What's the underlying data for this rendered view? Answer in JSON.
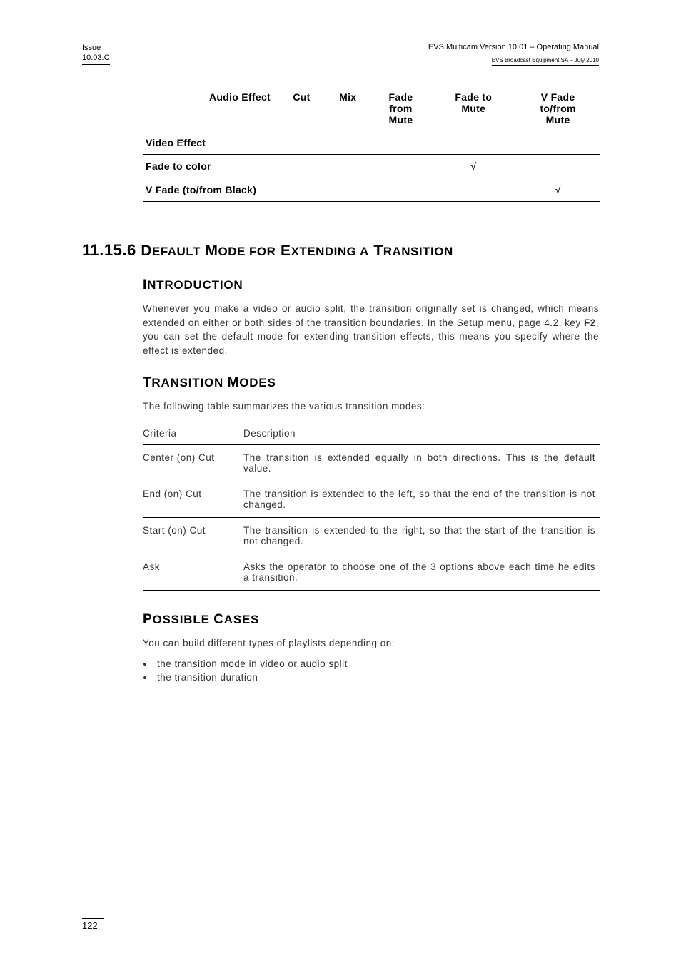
{
  "header": {
    "issue_label": "Issue",
    "issue_num": "10.03.C",
    "right_line1": "EVS Multicam Version 10.01 – Operating Manual",
    "right_line2": "EVS Broadcast Equipment SA – July 2010"
  },
  "effects_table": {
    "audio_effect_label": "Audio Effect",
    "headers": [
      "Cut",
      "Mix",
      "Fade from Mute",
      "Fade to Mute",
      "V Fade to/from Mute"
    ],
    "video_effect_label": "Video Effect",
    "rows": [
      {
        "label": "Fade to color",
        "marks": [
          "",
          "",
          "",
          "√",
          ""
        ]
      },
      {
        "label": "V Fade (to/from Black)",
        "marks": [
          "",
          "",
          "",
          "",
          "√"
        ]
      }
    ]
  },
  "section": {
    "number": "11.15.6",
    "title_word1_first": "D",
    "title_word1_rest": "EFAULT",
    "title_word2_first": "M",
    "title_word2_rest": "ODE FOR",
    "title_word3_first": "E",
    "title_word3_rest": "XTENDING A",
    "title_word4_first": "T",
    "title_word4_rest": "RANSITION"
  },
  "intro": {
    "heading_first": "I",
    "heading_rest": "NTRODUCTION",
    "text": "Whenever you make a video or audio split, the transition originally set is changed, which means extended on either or both sides of the transition boundaries. In the Setup menu, page 4.2, key F2, you can set the default mode for extending transition effects, this means you specify where the effect is extended."
  },
  "modes": {
    "heading_word1_first": "T",
    "heading_word1_rest": "RANSITION",
    "heading_word2_first": "M",
    "heading_word2_rest": "ODES",
    "intro": "The following table summarizes the various transition modes:",
    "col_criteria": "Criteria",
    "col_description": "Description",
    "rows": [
      {
        "crit": "Center (on) Cut",
        "desc": "The transition is extended equally in both directions. This is the default value."
      },
      {
        "crit": "End (on) Cut",
        "desc": "The transition is extended to the left, so that the end of the transition is not changed."
      },
      {
        "crit": "Start (on) Cut",
        "desc": "The transition is extended to the right, so that the start of the transition is not changed."
      },
      {
        "crit": "Ask",
        "desc": "Asks the operator to choose one of the 3 options above each time he edits a transition."
      }
    ]
  },
  "cases": {
    "heading_word1_first": "P",
    "heading_word1_rest": "OSSIBLE",
    "heading_word2_first": "C",
    "heading_word2_rest": "ASES",
    "intro": "You can build different types of playlists depending on:",
    "bullets": [
      "the transition mode in video or audio split",
      "the transition duration"
    ]
  },
  "page_number": "122"
}
